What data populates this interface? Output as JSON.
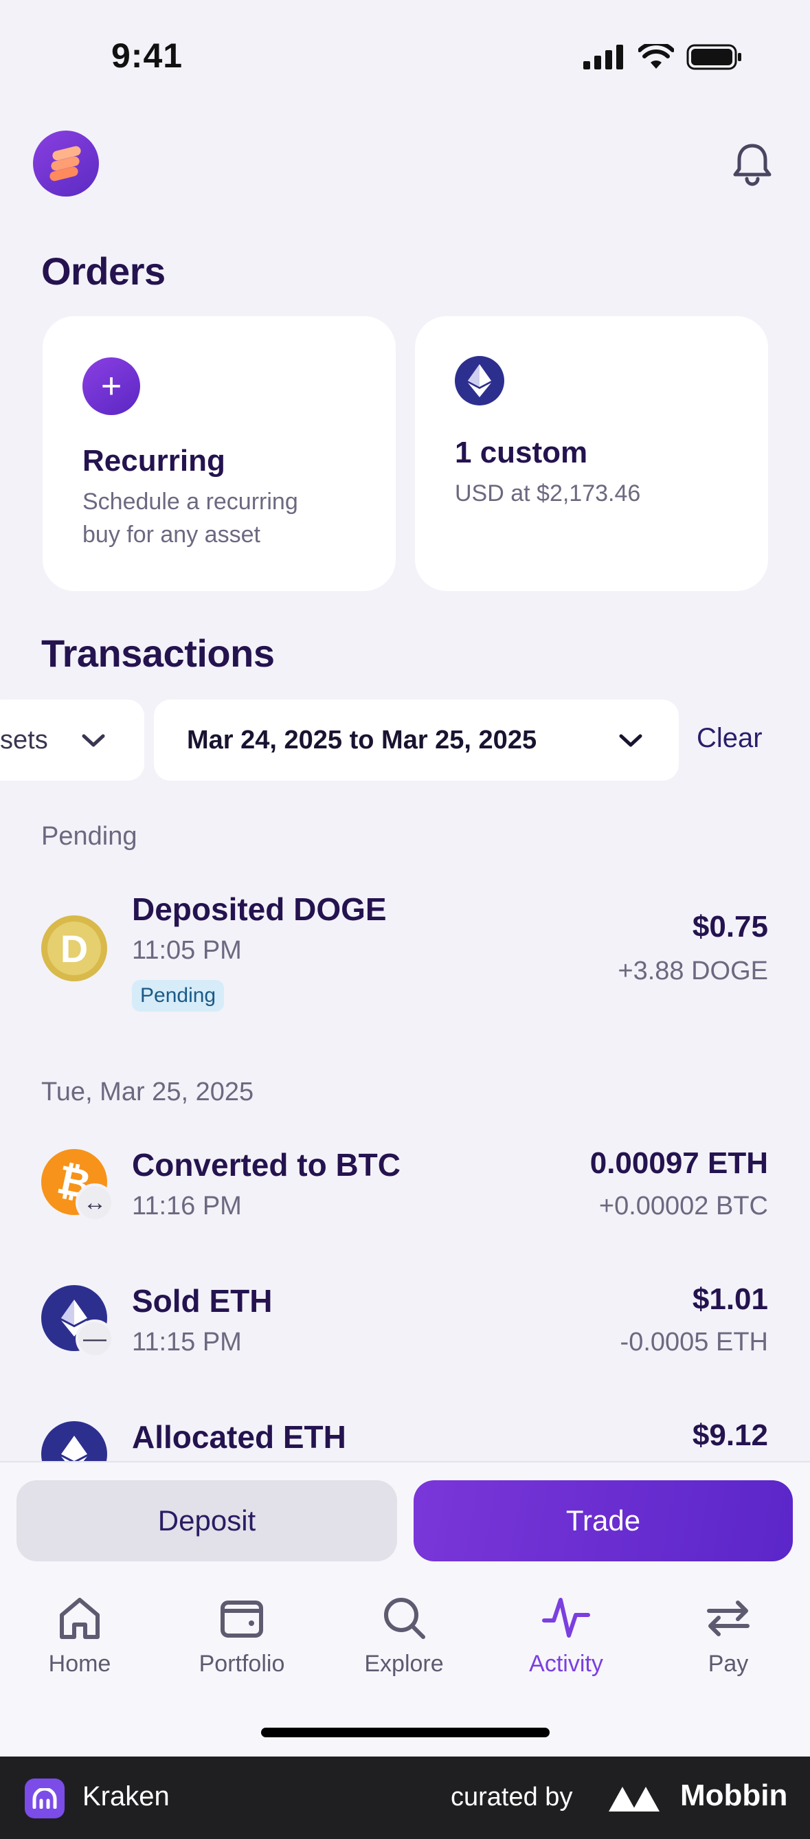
{
  "status_bar": {
    "time": "9:41"
  },
  "header": {
    "avatar_icon": "stacked-coins-icon",
    "notification_icon": "bell-icon"
  },
  "orders": {
    "title": "Orders",
    "recurring": {
      "icon": "plus-icon",
      "title": "Recurring",
      "subtitle_line1": "Schedule a recurring",
      "subtitle_line2": "buy for any asset"
    },
    "custom": {
      "icon": "eth-icon",
      "title": "1 custom",
      "subtitle": "USD at $2,173.46"
    }
  },
  "transactions": {
    "title": "Transactions",
    "filters": {
      "assets_label": "sets",
      "date_range": "Mar 24, 2025 to Mar 25, 2025",
      "clear_label": "Clear"
    },
    "groups": [
      {
        "label": "Pending",
        "items": [
          {
            "title": "Deposited DOGE",
            "time": "11:05 PM",
            "badge": "Pending",
            "amount": "$0.75",
            "sub": "+3.88 DOGE",
            "icon": "doge-icon"
          }
        ]
      },
      {
        "label": "Tue, Mar 25, 2025",
        "items": [
          {
            "title": "Converted to BTC",
            "time": "11:16 PM",
            "amount": "0.00097 ETH",
            "sub": "+0.00002 BTC",
            "icon": "btc-icon",
            "mini_icon": "convert-arrows-icon"
          },
          {
            "title": "Sold ETH",
            "time": "11:15 PM",
            "amount": "$1.01",
            "sub": "-0.0005 ETH",
            "icon": "eth-icon",
            "mini_icon": "minus-icon"
          },
          {
            "title": "Allocated ETH",
            "amount": "$9.12",
            "icon": "eth-icon"
          }
        ]
      }
    ]
  },
  "actions": {
    "deposit": "Deposit",
    "trade": "Trade"
  },
  "tabbar": [
    {
      "label": "Home",
      "icon": "home-icon",
      "active": false
    },
    {
      "label": "Portfolio",
      "icon": "wallet-icon",
      "active": false
    },
    {
      "label": "Explore",
      "icon": "search-icon",
      "active": false
    },
    {
      "label": "Activity",
      "icon": "activity-icon",
      "active": true
    },
    {
      "label": "Pay",
      "icon": "transfer-arrows-icon",
      "active": false
    }
  ],
  "footer": {
    "app_name": "Kraken",
    "curated_by": "curated by",
    "brand": "Mobbin"
  },
  "colors": {
    "accent": "#7b3fe0",
    "text_primary": "#24134f",
    "background": "#f3f2f8"
  }
}
